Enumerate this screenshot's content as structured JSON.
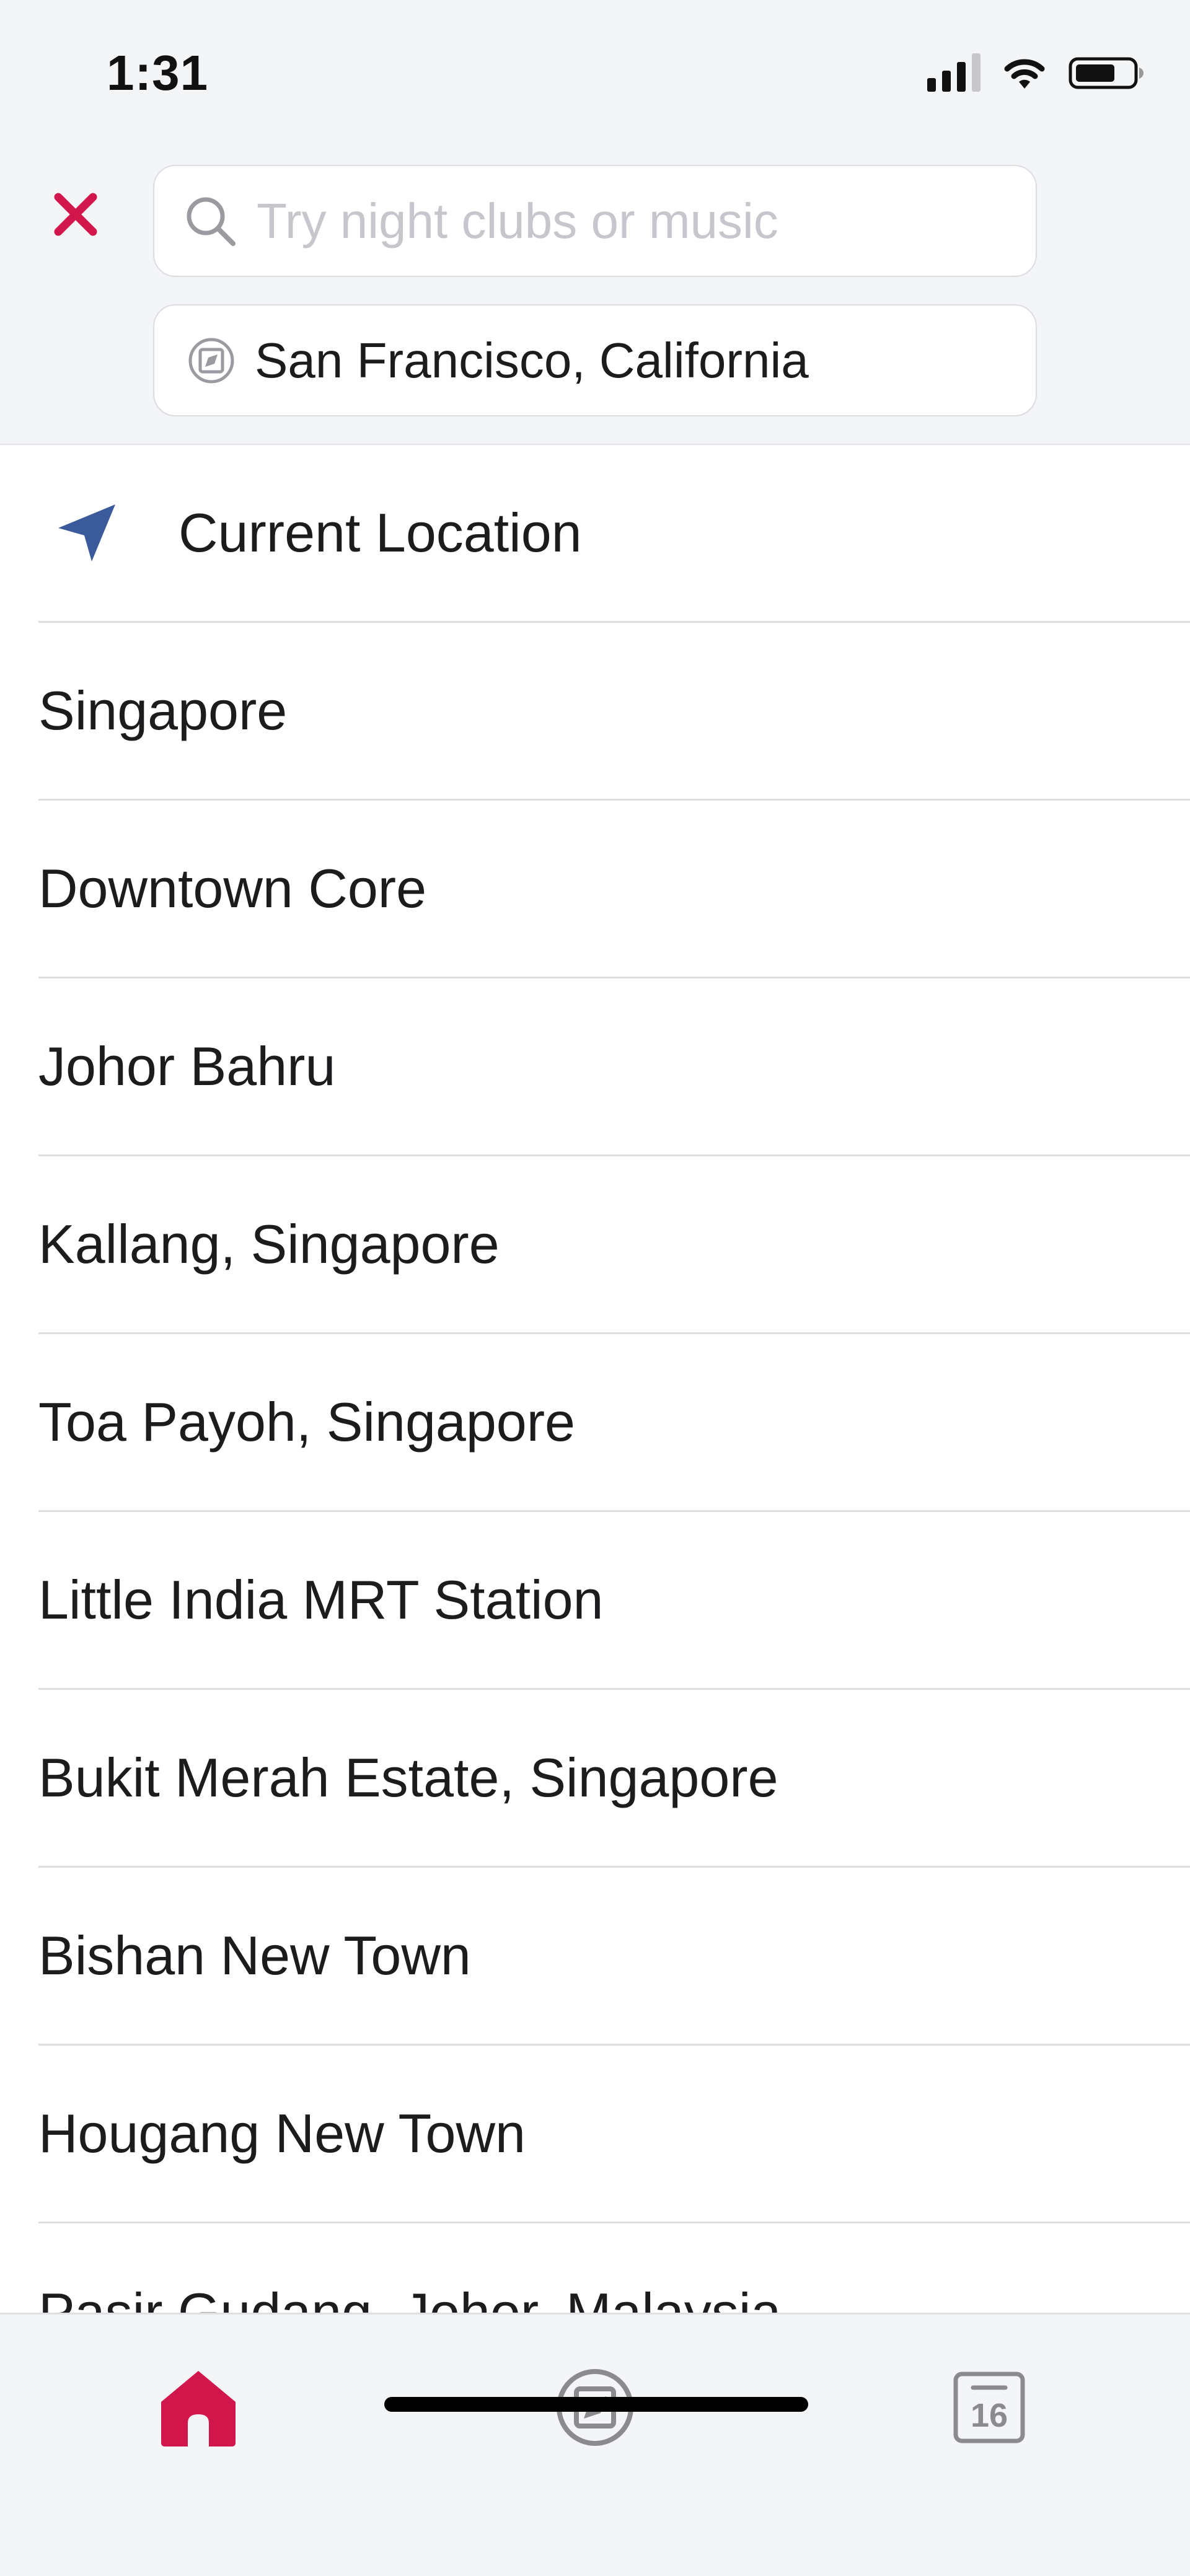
{
  "status_bar": {
    "time": "1:31"
  },
  "search": {
    "placeholder": "Try night clubs or music",
    "value": "",
    "location": "San Francisco, California"
  },
  "current_location": {
    "label": "Current Location"
  },
  "suggestions": [
    "Singapore",
    "Downtown Core",
    "Johor Bahru",
    "Kallang, Singapore",
    "Toa Payoh, Singapore",
    "Little India MRT Station",
    "Bukit Merah Estate, Singapore",
    "Bishan New Town",
    "Hougang New Town",
    "Pasir Gudang, Johor, Malaysia"
  ],
  "tabbar": {
    "calendar_day": "16",
    "active_tab": "home"
  },
  "colors": {
    "accent": "#d0164b",
    "nav_arrow": "#3a5a9c",
    "inactive_icon": "#8a8a8f",
    "header_bg": "#f4f5f7"
  },
  "icons": {
    "close": "close-icon",
    "search": "search-icon",
    "location_compass": "compass-icon",
    "current_location": "navigation-arrow-icon",
    "home_tab": "home-icon",
    "explore_tab": "compass-icon",
    "calendar_tab": "calendar-icon"
  }
}
